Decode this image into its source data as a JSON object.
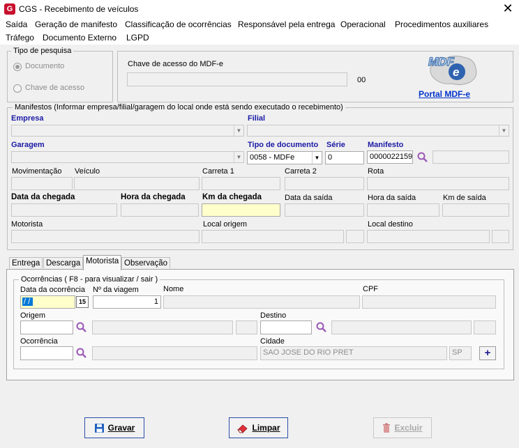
{
  "window": {
    "title": "CGS - Recebimento de veículos",
    "logo_letter": "G",
    "close_glyph": "✕"
  },
  "menu": [
    "Saída",
    "Geração de manifesto",
    "Classificação de ocorrências",
    "Responsável pela entrega",
    "Operacional",
    "Procedimentos auxiliares",
    "Tráfego",
    "Documento Externo",
    "LGPD"
  ],
  "tipo_pesquisa": {
    "legend": "Tipo de pesquisa",
    "options": [
      "Documento",
      "Chave de acesso"
    ],
    "selected": "Documento"
  },
  "mdfe": {
    "chave_label": "Chave de acesso do MDF-e",
    "chave_value": "",
    "counter": "00",
    "portal_link": "Portal MDF-e",
    "logo_text": "MDF e"
  },
  "manifestos": {
    "legend": "Manifestos (Informar empresa/filial/garagem do local onde está sendo executado o recebimento)",
    "labels": {
      "empresa": "Empresa",
      "filial": "Filial",
      "garagem": "Garagem",
      "tipo_documento": "Tipo de documento",
      "serie": "Série",
      "manifesto": "Manifesto",
      "movimentacao": "Movimentação",
      "veiculo": "Veículo",
      "carreta1": "Carreta 1",
      "carreta2": "Carreta 2",
      "rota": "Rota",
      "data_chegada": "Data da chegada",
      "hora_chegada": "Hora da chegada",
      "km_chegada": "Km da chegada",
      "data_saida": "Data da saída",
      "hora_saida": "Hora da saída",
      "km_saida": "Km de saída",
      "motorista": "Motorista",
      "local_origem": "Local origem",
      "local_destino": "Local destino"
    },
    "values": {
      "tipo_documento": "0058 - MDFe",
      "serie": "0",
      "manifesto": "0000022159"
    }
  },
  "tabs": [
    "Entrega",
    "Descarga",
    "Motorista",
    "Observação"
  ],
  "active_tab": "Motorista",
  "ocorrencias": {
    "legend": "Ocorrências ( F8 - para visualizar / sair )",
    "labels": {
      "data_ocorrencia": "Data da ocorrência",
      "num_viagem": "Nº da viagem",
      "nome": "Nome",
      "cpf": "CPF",
      "origem": "Origem",
      "destino": "Destino",
      "ocorrencia": "Ocorrência",
      "cidade": "Cidade"
    },
    "values": {
      "data_ocorrencia": " /  /",
      "num_viagem": "1",
      "cidade": "SAO JOSE DO RIO PRET",
      "uf": "SP"
    },
    "calendar_glyph": "15",
    "add_glyph": "+"
  },
  "buttons": {
    "gravar": "Gravar",
    "limpar": "Limpar",
    "excluir": "Excluir"
  },
  "colors": {
    "link": "#0033cc",
    "label_blue": "#1a1aa6",
    "selection": "#0078d7",
    "km_highlight": "#ffffcc"
  }
}
